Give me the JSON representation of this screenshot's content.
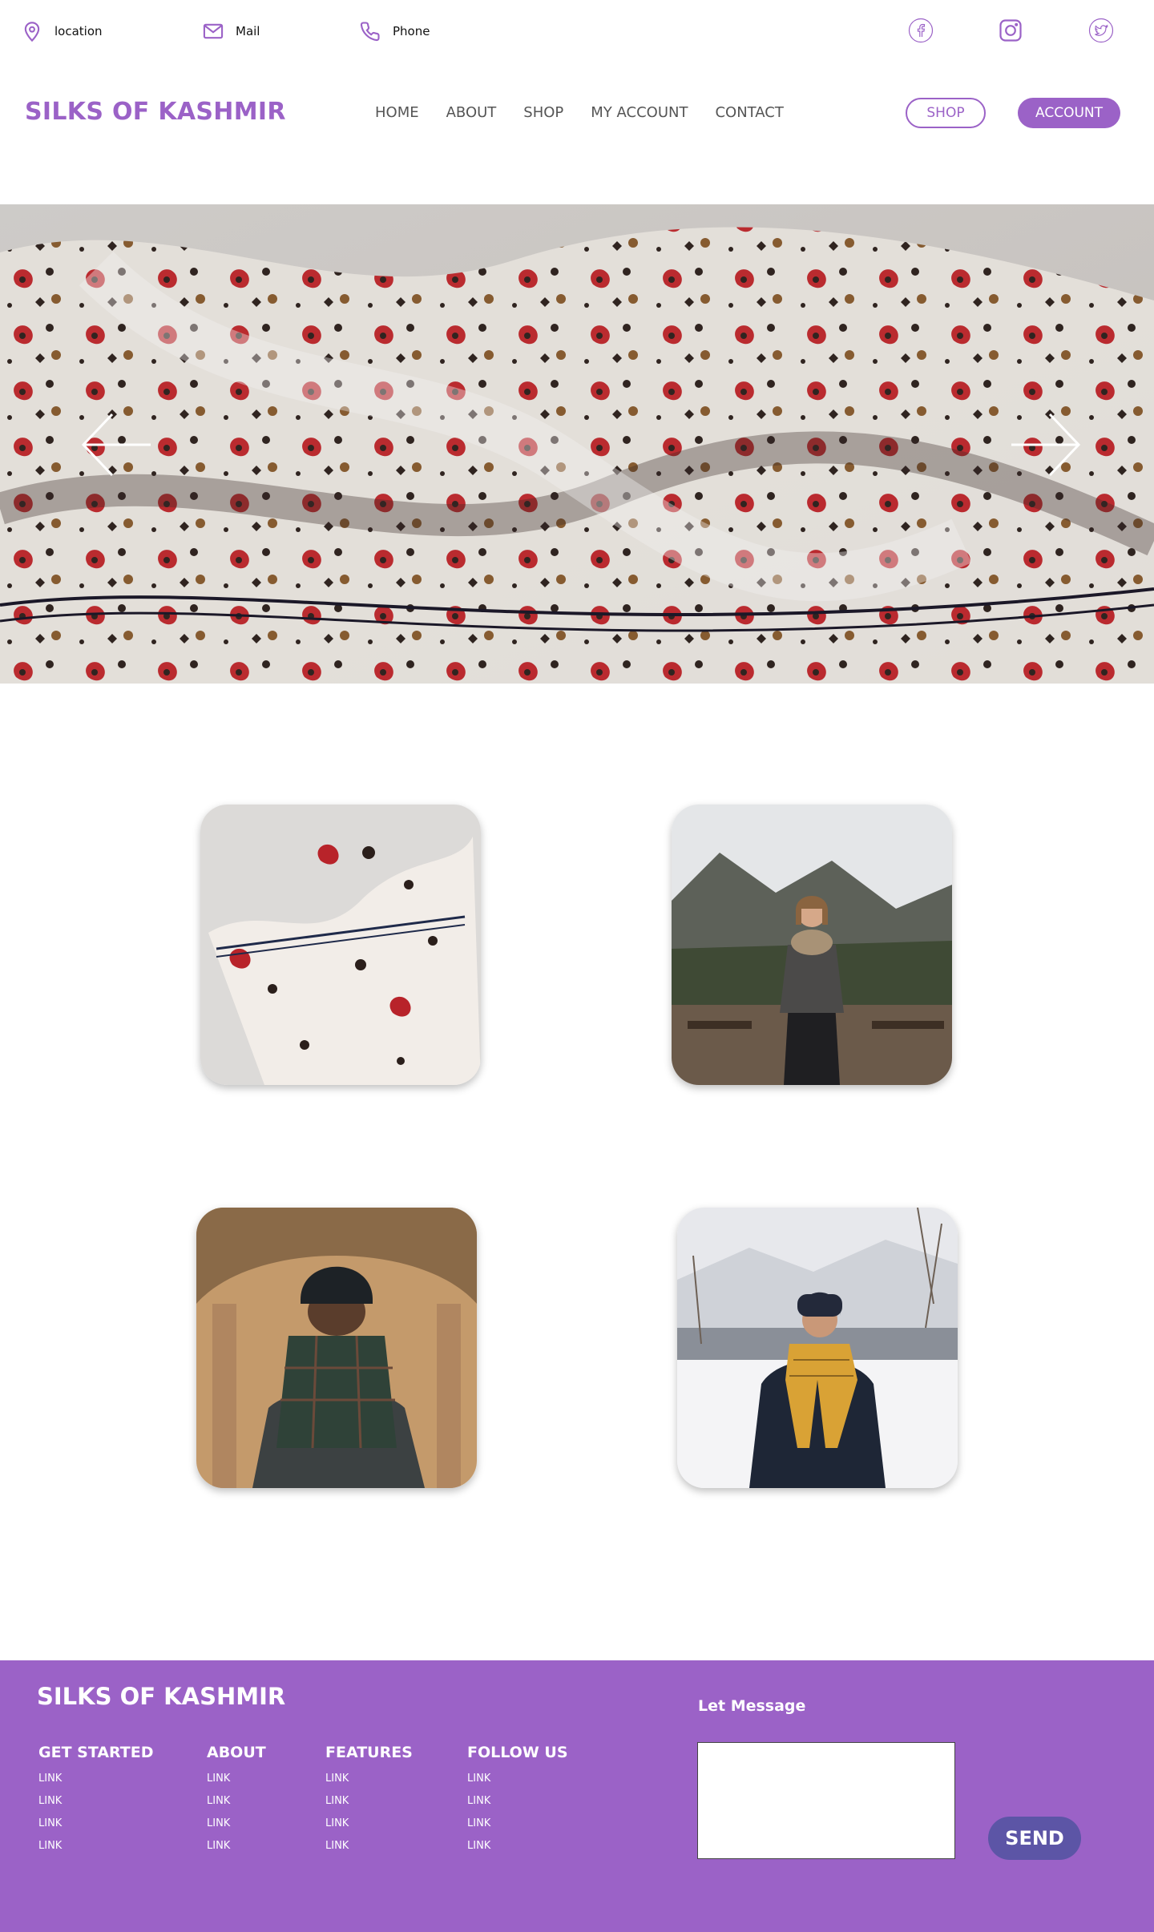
{
  "colors": {
    "accent": "#9b62c7",
    "send_button": "#5c55a6",
    "footer_bg": "#9b62c7"
  },
  "topbar": {
    "location": {
      "icon": "location-pin-icon",
      "label": "location"
    },
    "mail": {
      "icon": "mail-icon",
      "label": "Mail"
    },
    "phone": {
      "icon": "phone-icon",
      "label": "Phone"
    },
    "social": [
      "facebook-icon",
      "instagram-icon",
      "twitter-icon"
    ]
  },
  "header": {
    "brand": "SILKS OF KASHMIR",
    "nav": [
      "HOME",
      "ABOUT",
      "SHOP",
      "MY ACCOUNT",
      "CONTACT"
    ],
    "shop_button": "SHOP",
    "account_button": "ACCOUNT"
  },
  "hero": {
    "image": "paisley-silk-scarf-photo",
    "prev_icon": "arrow-left-icon",
    "next_icon": "arrow-right-icon"
  },
  "products": [
    {
      "image": "folded-paisley-scarf-photo"
    },
    {
      "image": "woman-knit-scarf-mountains-photo"
    },
    {
      "image": "man-plaid-scarf-photo"
    },
    {
      "image": "woman-yellow-scarf-snow-photo"
    }
  ],
  "footer": {
    "brand": "SILKS OF KASHMIR",
    "columns": [
      {
        "title": "GET STARTED",
        "links": [
          "LINK",
          "LINK",
          "LINK",
          "LINK"
        ]
      },
      {
        "title": "ABOUT",
        "links": [
          "LINK",
          "LINK",
          "LINK",
          "LINK"
        ]
      },
      {
        "title": "FEATURES",
        "links": [
          "LINK",
          "LINK",
          "LINK",
          "LINK"
        ]
      },
      {
        "title": "FOLLOW US",
        "links": [
          "LINK",
          "LINK",
          "LINK",
          "LINK"
        ]
      }
    ],
    "message_label": "Let Message",
    "message_value": "",
    "send_button": "SEND"
  }
}
